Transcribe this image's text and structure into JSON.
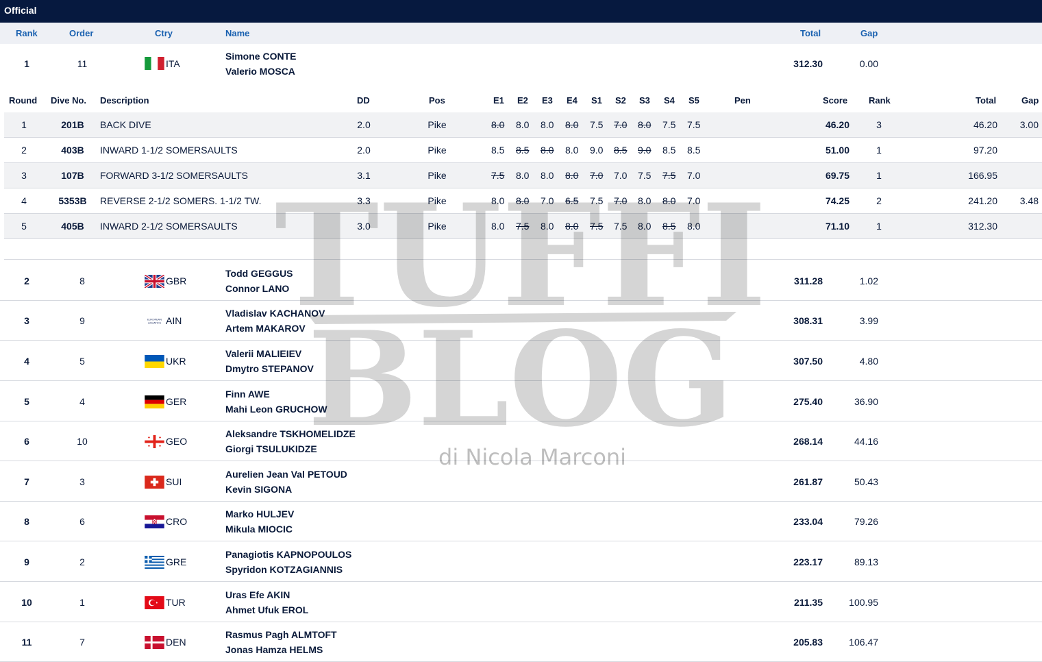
{
  "header": {
    "title": "Official"
  },
  "columns": {
    "rank": "Rank",
    "order": "Order",
    "ctry": "Ctry",
    "name": "Name",
    "total": "Total",
    "gap": "Gap"
  },
  "dive_columns": {
    "round": "Round",
    "dive_no": "Dive No.",
    "description": "Description",
    "dd": "DD",
    "pos": "Pos",
    "e1": "E1",
    "e2": "E2",
    "e3": "E3",
    "e4": "E4",
    "s1": "S1",
    "s2": "S2",
    "s3": "S3",
    "s4": "S4",
    "s5": "S5",
    "pen": "Pen",
    "score": "Score",
    "rank": "Rank",
    "total": "Total",
    "gap": "Gap"
  },
  "leader": {
    "rank": "1",
    "order": "11",
    "ctry": "ITA",
    "name1": "Simone CONTE",
    "name2": "Valerio MOSCA",
    "total": "312.30",
    "gap": "0.00"
  },
  "dives": [
    {
      "round": "1",
      "dive_no": "201B",
      "description": "BACK DIVE",
      "dd": "2.0",
      "pos": "Pike",
      "e1": "8.0",
      "e2": "8.0",
      "e3": "8.0",
      "e4": "8.0",
      "s1": "7.5",
      "s2": "7.0",
      "s3": "8.0",
      "s4": "7.5",
      "s5": "7.5",
      "score": "46.20",
      "rank": "3",
      "total": "46.20",
      "gap": "3.00"
    },
    {
      "round": "2",
      "dive_no": "403B",
      "description": "INWARD 1-1/2 SOMERSAULTS",
      "dd": "2.0",
      "pos": "Pike",
      "e1": "8.5",
      "e2": "8.5",
      "e3": "8.0",
      "e4": "8.0",
      "s1": "9.0",
      "s2": "8.5",
      "s3": "9.0",
      "s4": "8.5",
      "s5": "8.5",
      "score": "51.00",
      "rank": "1",
      "total": "97.20",
      "gap": ""
    },
    {
      "round": "3",
      "dive_no": "107B",
      "description": "FORWARD 3-1/2 SOMERSAULTS",
      "dd": "3.1",
      "pos": "Pike",
      "e1": "7.5",
      "e2": "8.0",
      "e3": "8.0",
      "e4": "8.0",
      "s1": "7.0",
      "s2": "7.0",
      "s3": "7.5",
      "s4": "7.5",
      "s5": "7.0",
      "score": "69.75",
      "rank": "1",
      "total": "166.95",
      "gap": ""
    },
    {
      "round": "4",
      "dive_no": "5353B",
      "description": "REVERSE 2-1/2 SOMERS. 1-1/2 TW.",
      "dd": "3.3",
      "pos": "Pike",
      "e1": "8.0",
      "e2": "8.0",
      "e3": "7.0",
      "e4": "6.5",
      "s1": "7.5",
      "s2": "7.0",
      "s3": "8.0",
      "s4": "8.0",
      "s5": "7.0",
      "score": "74.25",
      "rank": "2",
      "total": "241.20",
      "gap": "3.48"
    },
    {
      "round": "5",
      "dive_no": "405B",
      "description": "INWARD 2-1/2 SOMERSAULTS",
      "dd": "3.0",
      "pos": "Pike",
      "e1": "8.0",
      "e2": "7.5",
      "e3": "8.0",
      "e4": "8.0",
      "s1": "7.5",
      "s2": "7.5",
      "s3": "8.0",
      "s4": "8.5",
      "s5": "8.0",
      "score": "71.10",
      "rank": "1",
      "total": "312.30",
      "gap": ""
    }
  ],
  "struck": [
    [
      "e1",
      "e4",
      "s2",
      "s3"
    ],
    [
      "e2",
      "e3",
      "s2",
      "s3"
    ],
    [
      "e1",
      "e4",
      "s1",
      "s4"
    ],
    [
      "e2",
      "e4",
      "s2",
      "s4"
    ],
    [
      "e2",
      "e4",
      "s1",
      "s4"
    ]
  ],
  "results": [
    {
      "rank": "2",
      "order": "8",
      "ctry": "GBR",
      "name1": "Todd GEGGUS",
      "name2": "Connor LANO",
      "total": "311.28",
      "gap": "1.02"
    },
    {
      "rank": "3",
      "order": "9",
      "ctry": "AIN",
      "name1": "Vladislav KACHANOV",
      "name2": "Artem MAKAROV",
      "total": "308.31",
      "gap": "3.99"
    },
    {
      "rank": "4",
      "order": "5",
      "ctry": "UKR",
      "name1": "Valerii MALIEIEV",
      "name2": "Dmytro STEPANOV",
      "total": "307.50",
      "gap": "4.80"
    },
    {
      "rank": "5",
      "order": "4",
      "ctry": "GER",
      "name1": "Finn AWE",
      "name2": "Mahi Leon GRUCHOW",
      "total": "275.40",
      "gap": "36.90"
    },
    {
      "rank": "6",
      "order": "10",
      "ctry": "GEO",
      "name1": "Aleksandre TSKHOMELIDZE",
      "name2": "Giorgi TSULUKIDZE",
      "total": "268.14",
      "gap": "44.16"
    },
    {
      "rank": "7",
      "order": "3",
      "ctry": "SUI",
      "name1": "Aurelien Jean Val PETOUD",
      "name2": "Kevin SIGONA",
      "total": "261.87",
      "gap": "50.43"
    },
    {
      "rank": "8",
      "order": "6",
      "ctry": "CRO",
      "name1": "Marko HULJEV",
      "name2": "Mikula MIOCIC",
      "total": "233.04",
      "gap": "79.26"
    },
    {
      "rank": "9",
      "order": "2",
      "ctry": "GRE",
      "name1": "Panagiotis KAPNOPOULOS",
      "name2": "Spyridon KOTZAGIANNIS",
      "total": "223.17",
      "gap": "89.13"
    },
    {
      "rank": "10",
      "order": "1",
      "ctry": "TUR",
      "name1": "Uras Efe AKIN",
      "name2": "Ahmet Ufuk EROL",
      "total": "211.35",
      "gap": "100.95"
    },
    {
      "rank": "11",
      "order": "7",
      "ctry": "DEN",
      "name1": "Rasmus Pagh ALMTOFT",
      "name2": "Jonas Hamza HELMS",
      "total": "205.83",
      "gap": "106.47"
    }
  ],
  "flag_labels": {
    "ain": "EUROPEAN AQUATICS"
  },
  "watermark": {
    "line1": "TUFFI",
    "line2": "BLOG",
    "byline": "di Nicola Marconi"
  }
}
